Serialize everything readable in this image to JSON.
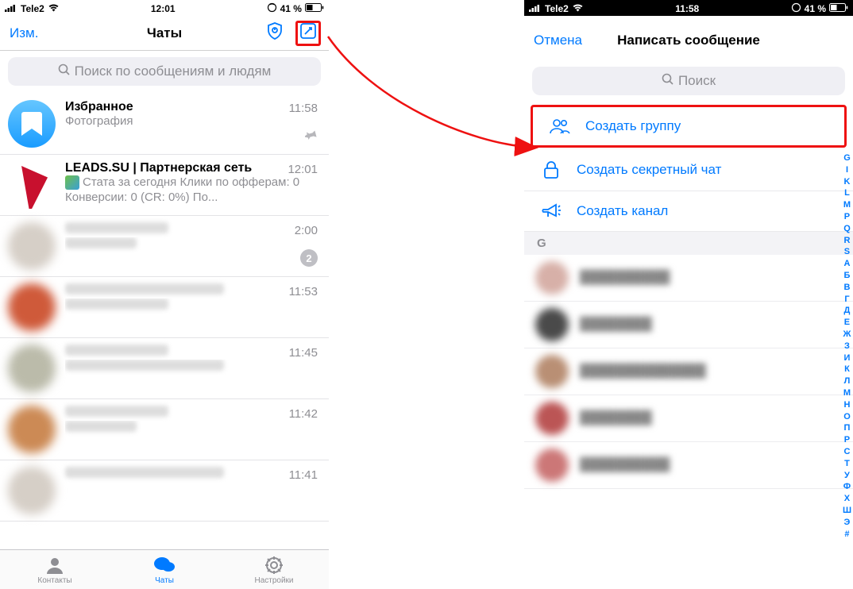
{
  "left": {
    "status": {
      "carrier": "Tele2",
      "time": "12:01",
      "battery": "41 %"
    },
    "nav": {
      "edit": "Изм.",
      "title": "Чаты"
    },
    "search_placeholder": "Поиск по сообщениям и людям",
    "chats": [
      {
        "title": "Избранное",
        "sub": "Фотография",
        "time": "11:58",
        "pinned": true
      },
      {
        "title": "LEADS.SU | Партнерская сеть",
        "sub": "Стата за сегодня Клики по офферам: 0 Конверсии: 0 (CR: 0%) По...",
        "time": "12:01"
      },
      {
        "time": "2:00",
        "badge": "2"
      },
      {
        "time": "11:53"
      },
      {
        "time": "11:45"
      },
      {
        "time": "11:42"
      },
      {
        "time": "11:41"
      }
    ],
    "tabs": {
      "contacts": "Контакты",
      "chats": "Чаты",
      "settings": "Настройки"
    }
  },
  "right": {
    "status": {
      "carrier": "Tele2",
      "time": "11:58",
      "battery": "41 %"
    },
    "nav": {
      "cancel": "Отмена",
      "title": "Написать сообщение"
    },
    "search_placeholder": "Поиск",
    "actions": {
      "group": "Создать группу",
      "secret": "Создать секретный чат",
      "channel": "Создать канал"
    },
    "section": "G",
    "index": [
      "G",
      "I",
      "K",
      "L",
      "M",
      "P",
      "Q",
      "R",
      "S",
      "А",
      "Б",
      "В",
      "Г",
      "Д",
      "Е",
      "Ж",
      "З",
      "И",
      "К",
      "Л",
      "М",
      "Н",
      "О",
      "П",
      "Р",
      "С",
      "Т",
      "У",
      "Ф",
      "Х",
      "Ш",
      "Э",
      "#"
    ]
  }
}
